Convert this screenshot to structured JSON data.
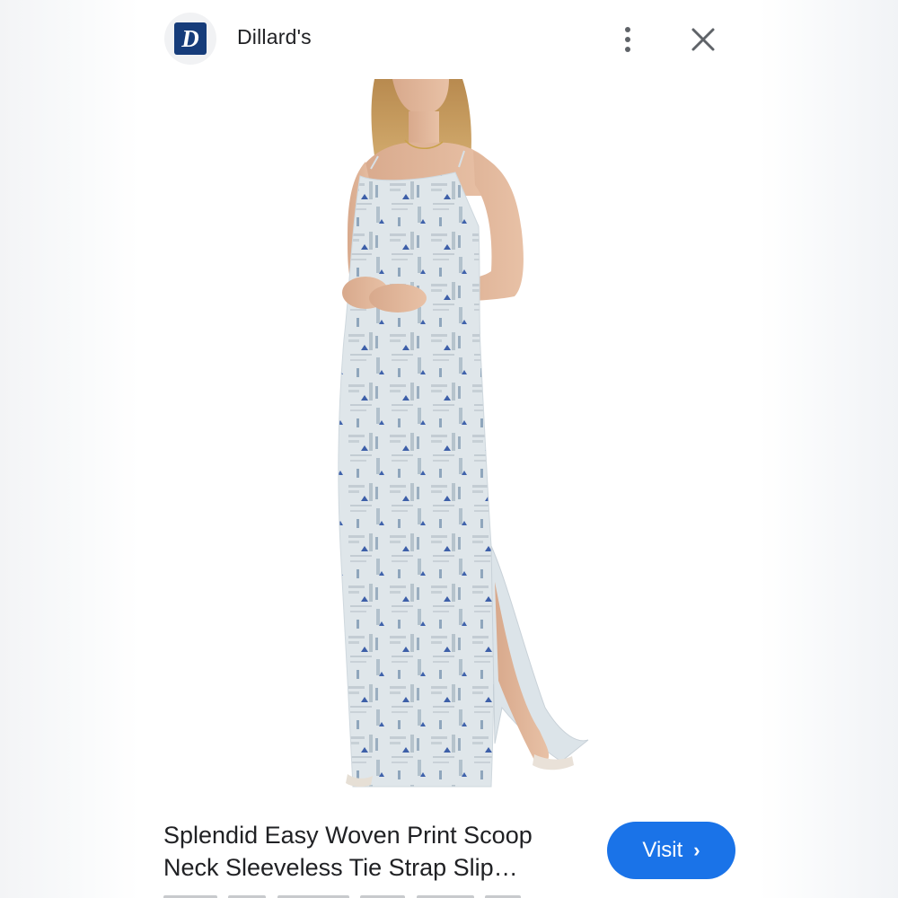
{
  "header": {
    "logo_letter": "D",
    "site_name": "Dillard's",
    "menu_icon": "more-vert-icon",
    "close_icon": "close-icon"
  },
  "product": {
    "title_line1": "Splendid Easy Woven Print Scoop",
    "title_line2": "Neck Sleeveless Tie Strap Slip…",
    "image_icon": "product-photo-dress"
  },
  "actions": {
    "visit_label": "Visit",
    "visit_icon": "chevron-right-icon"
  },
  "colors": {
    "accent": "#1a73e8",
    "logo_bg": "#163c7a",
    "text": "#202124"
  }
}
